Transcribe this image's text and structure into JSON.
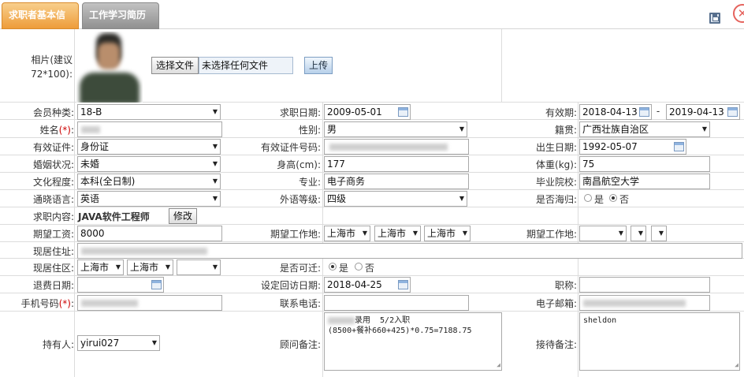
{
  "tabs": [
    {
      "label": "求职者基本信息",
      "active": true
    },
    {
      "label": "工作学习简历",
      "active": false
    }
  ],
  "form": {
    "photo": {
      "label": "相片(建议72*100):",
      "choose_button": "选择文件",
      "no_file": "未选择任何文件",
      "upload_button": "上传"
    },
    "member_type": {
      "label": "会员种类:",
      "value": "18-B"
    },
    "job_date": {
      "label": "求职日期:",
      "value": "2009-05-01"
    },
    "validity": {
      "label": "有效期:",
      "start": "2018-04-13",
      "separator": "-",
      "end": "2019-04-13"
    },
    "name": {
      "label": "姓名",
      "required_mark": "(*)",
      "suffix": ":"
    },
    "gender": {
      "label": "性别:",
      "value": "男"
    },
    "native_place": {
      "label": "籍贯:",
      "value": "广西壮族自治区"
    },
    "id_type": {
      "label": "有效证件:",
      "value": "身份证"
    },
    "id_number": {
      "label": "有效证件号码:"
    },
    "birth_date": {
      "label": "出生日期:",
      "value": "1992-05-07"
    },
    "marital": {
      "label": "婚姻状况:",
      "value": "未婚"
    },
    "height": {
      "label": "身高(cm):",
      "value": "177"
    },
    "weight": {
      "label": "体重(kg):",
      "value": "75"
    },
    "education": {
      "label": "文化程度:",
      "value": "本科(全日制)"
    },
    "major": {
      "label": "专业:",
      "value": "电子商务"
    },
    "school": {
      "label": "毕业院校:",
      "value": "南昌航空大学"
    },
    "language": {
      "label": "通晓语言:",
      "value": "英语"
    },
    "language_level": {
      "label": "外语等级:",
      "value": "四级"
    },
    "returnee": {
      "label": "是否海归:",
      "options": [
        "是",
        "否"
      ],
      "selected": "否"
    },
    "job_content": {
      "label": "求职内容:",
      "value": "JAVA软件工程师",
      "edit_button": "修改"
    },
    "expected_salary": {
      "label": "期望工资:",
      "value": "8000"
    },
    "expected_location": {
      "label": "期望工作地:",
      "province": "上海市",
      "city": "上海市",
      "district": "上海市"
    },
    "expected_location_2": {
      "label": "期望工作地:"
    },
    "current_address": {
      "label": "现居住址:"
    },
    "current_area": {
      "label": "现居住区:",
      "province": "上海市",
      "city": "上海市"
    },
    "relocate": {
      "label": "是否可迁:",
      "options": [
        "是",
        "否"
      ],
      "selected": "是"
    },
    "refund_date": {
      "label": "退费日期:"
    },
    "revisit_date": {
      "label": "设定回访日期:",
      "value": "2018-04-25"
    },
    "title": {
      "label": "职称:"
    },
    "mobile": {
      "label": "手机号码",
      "required_mark": "(*)",
      "suffix": ":"
    },
    "phone": {
      "label": "联系电话:"
    },
    "email": {
      "label": "电子邮箱:"
    },
    "holder": {
      "label": "持有人:",
      "value": "yirui027"
    },
    "consultant_note": {
      "label": "顾问备注:",
      "line1": "录用  5/2入职",
      "line2": "(8500+餐补660+425)*0.75=7188.75"
    },
    "reception_note": {
      "label": "接待备注:",
      "value": "sheldon"
    }
  },
  "icons": {
    "save": "save-icon",
    "close": "close-icon",
    "calendar": "calendar-icon"
  },
  "colors": {
    "active_tab": "#ee9c3a",
    "inactive_tab": "#909090",
    "required": "#cc0000",
    "close": "#e5625c"
  }
}
